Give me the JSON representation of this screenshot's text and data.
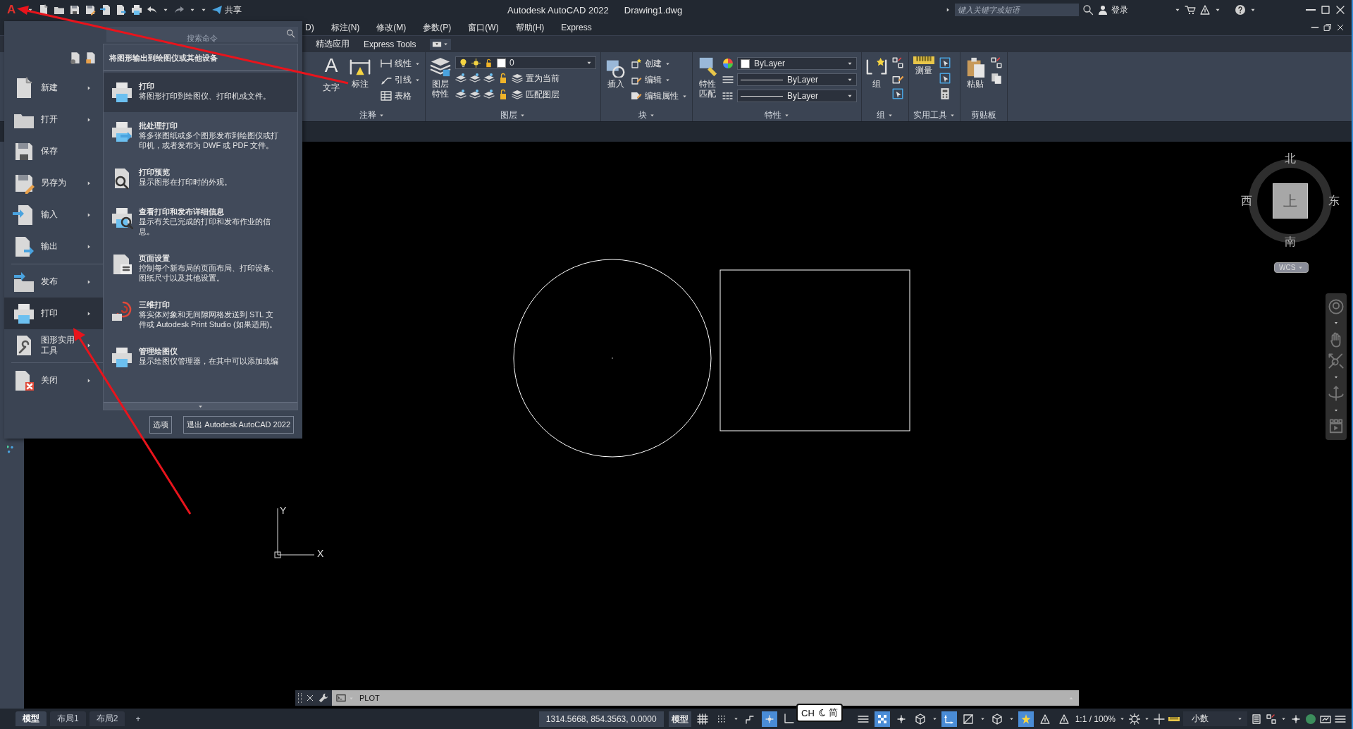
{
  "title_bar": {
    "logo": "A",
    "share": "共享",
    "app_title": "Autodesk AutoCAD 2022",
    "file_name": "Drawing1.dwg",
    "search": {
      "placeholder": "键入关键字或短语"
    },
    "sign_in": "登录"
  },
  "menu_bar": [
    "D)",
    "标注(N)",
    "修改(M)",
    "参数(P)",
    "窗口(W)",
    "帮助(H)",
    "Express"
  ],
  "ribbon_tabs": [
    "精选应用",
    "Express Tools"
  ],
  "ribbon_panels": [
    {
      "kind": "annotation",
      "title": "注释",
      "has_menu": true,
      "large": [
        {
          "label": "文字",
          "glyph": "A"
        },
        {
          "label": "标注"
        }
      ],
      "small": [
        "线性",
        "引线",
        "表格"
      ]
    },
    {
      "kind": "layers",
      "title": "图层",
      "has_menu": true,
      "large": [
        {
          "label": "图层特性"
        }
      ],
      "layer": "0",
      "small": [
        "置为当前",
        "匹配图层"
      ]
    },
    {
      "kind": "block",
      "title": "块",
      "has_menu": true,
      "large": [
        {
          "label": "插入"
        }
      ],
      "small": [
        "创建",
        "编辑",
        "编辑属性"
      ]
    },
    {
      "kind": "properties",
      "title": "特性",
      "has_menu": true,
      "large": [
        {
          "label": "特性匹配"
        }
      ],
      "dropdowns": [
        "ByLayer",
        "ByLayer",
        "ByLayer"
      ]
    },
    {
      "kind": "group",
      "title": "组",
      "has_menu": true,
      "large": [
        {
          "label": "组"
        }
      ]
    },
    {
      "kind": "utilities",
      "title": "实用工具",
      "has_menu": true,
      "large": [
        {
          "label": "测量"
        }
      ]
    },
    {
      "kind": "clipboard",
      "title": "剪贴板",
      "has_menu": false,
      "large": [
        {
          "label": "粘贴"
        }
      ]
    }
  ],
  "app_menu": {
    "search": {
      "placeholder": "搜索命令"
    },
    "items": [
      {
        "label": "新建",
        "has_submenu": true,
        "selected": false
      },
      {
        "label": "打开",
        "has_submenu": true,
        "selected": false
      },
      {
        "label": "保存",
        "has_submenu": false,
        "selected": false
      },
      {
        "label": "另存为",
        "has_submenu": true,
        "selected": false
      },
      {
        "label": "输入",
        "has_submenu": true,
        "selected": false
      },
      {
        "label": "输出",
        "has_submenu": true,
        "selected": false
      },
      {
        "label": "发布",
        "has_submenu": true,
        "selected": false
      },
      {
        "label": "打印",
        "has_submenu": true,
        "selected": true
      },
      {
        "label": "图形实用工具",
        "has_submenu": true,
        "selected": false
      },
      {
        "label": "关闭",
        "has_submenu": true,
        "selected": false
      }
    ],
    "panel_title": "将图形输出到绘图仪或其他设备",
    "entries": [
      {
        "title": "打印",
        "description": "将图形打印到绘图仪、打印机或文件。",
        "selected": true
      },
      {
        "title": "批处理打印",
        "description": "将多张图纸或多个图形发布到绘图仪或打印机，或者发布为 DWF 或 PDF 文件。",
        "selected": false
      },
      {
        "title": "打印预览",
        "description": "显示图形在打印时的外观。",
        "selected": false
      },
      {
        "title": "查看打印和发布详细信息",
        "description": "显示有关已完成的打印和发布作业的信息。",
        "selected": false
      },
      {
        "title": "页面设置",
        "description": "控制每个新布局的页面布局、打印设备、图纸尺寸以及其他设置。",
        "selected": false
      },
      {
        "title": "三维打印",
        "description": "将实体对象和无间隙网格发送到 STL 文件或 Autodesk Print Studio (如果适用)。",
        "selected": false
      },
      {
        "title": "管理绘图仪",
        "description": "显示绘图仪管理器，在其中可以添加或编",
        "selected": false
      }
    ],
    "buttons": [
      "选项",
      "退出 Autodesk AutoCAD 2022"
    ]
  },
  "viewcube": {
    "north": "北",
    "south": "南",
    "west": "西",
    "east": "东",
    "face": "上",
    "wcs": "WCS"
  },
  "ucs": {
    "x": "X",
    "y": "Y"
  },
  "command_line": {
    "text": "PLOT"
  },
  "status_bar": {
    "layout_tabs": [
      {
        "label": "模型",
        "selected": true
      },
      {
        "label": "布局1",
        "selected": false
      },
      {
        "label": "布局2",
        "selected": false
      }
    ],
    "add_tab": "+",
    "coordinates": "1314.5668, 854.3563, 0.0000",
    "space": "模型",
    "toggles": [
      {
        "on": false
      },
      {
        "on": false
      },
      {
        "on": false
      },
      {
        "on": true
      },
      {
        "on": false
      },
      {
        "on": false
      },
      {
        "on": true
      },
      {
        "on": false
      },
      {
        "on": false
      },
      {
        "on": true
      },
      {
        "on": false
      },
      {
        "on": false
      },
      {
        "on": true
      },
      {
        "on": false
      },
      {
        "on": false
      }
    ],
    "scale": "1:1 / 100%",
    "units": "小数"
  },
  "ime": {
    "mode": "CH",
    "script": "简"
  }
}
